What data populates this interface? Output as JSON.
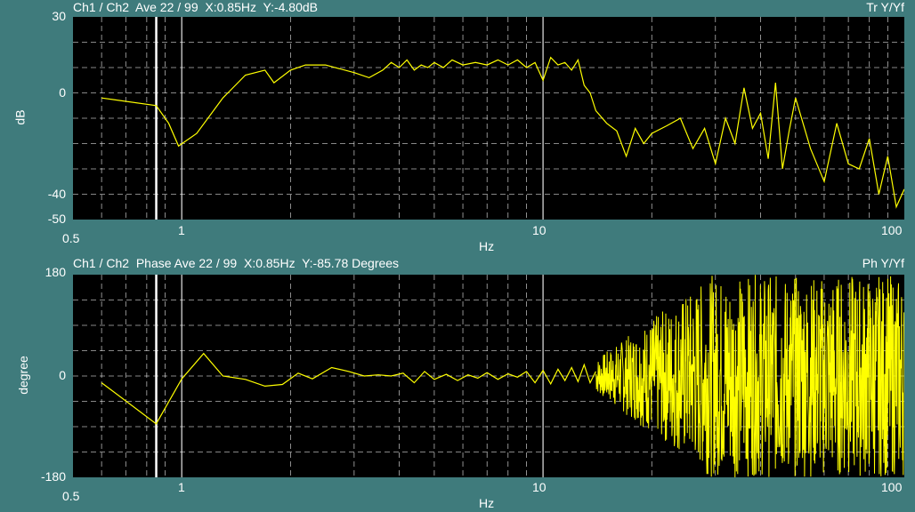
{
  "panels": [
    {
      "title": "Ch1 / Ch2  Ave 22 / 99  X:0.85Hz  Y:-4.80dB",
      "mode": "Tr Y/Yf",
      "ylabel": "dB",
      "xlabel": "Hz",
      "yticks": [
        "30",
        "0",
        "-40",
        "-50"
      ],
      "xticks": [
        "0.5",
        "1",
        "10",
        "100"
      ]
    },
    {
      "title": "Ch1 / Ch2  Phase Ave 22 / 99  X:0.85Hz  Y:-85.78 Degrees",
      "mode": "Ph Y/Yf",
      "ylabel": "degree",
      "xlabel": "Hz",
      "yticks": [
        "180",
        "0",
        "-180"
      ],
      "xticks": [
        "0.5",
        "1",
        "10",
        "100"
      ]
    }
  ],
  "colors": {
    "background": "#3f7b7c",
    "plot": "#000000",
    "trace": "#ffff00",
    "grid": "#ffffff",
    "cursor": "#ffffff"
  },
  "chart_data": [
    {
      "type": "line",
      "xscale": "log",
      "xlim": [
        0.5,
        100
      ],
      "ylim": [
        -50,
        30
      ],
      "cursor_x": 0.85,
      "series": [
        {
          "x": [
            0.6,
            0.85,
            0.92,
            0.98,
            1.1,
            1.3,
            1.5,
            1.7,
            1.8,
            2.0,
            2.2,
            2.5,
            3.0,
            3.3,
            3.6,
            3.8,
            4.0,
            4.2,
            4.4,
            4.6,
            4.8,
            5.0,
            5.3,
            5.6,
            6.0,
            6.5,
            7.0,
            7.5,
            8.0,
            8.5,
            9.0,
            9.5,
            10,
            10.5,
            11,
            11.5,
            12,
            12.5,
            13,
            13.5,
            14,
            15,
            16,
            17,
            18,
            19,
            20,
            22,
            24,
            26,
            28,
            30,
            32,
            34,
            36,
            38,
            40,
            42,
            44,
            46,
            48,
            50,
            55,
            60,
            65,
            70,
            75,
            80,
            85,
            90,
            95,
            100
          ],
          "y": [
            -2,
            -5,
            -12,
            -21,
            -16,
            -2,
            7,
            9,
            4,
            9,
            11,
            11,
            8,
            6,
            9,
            12,
            10,
            13,
            9,
            11,
            10,
            12,
            10,
            13,
            11,
            12,
            11,
            13,
            11,
            13,
            10,
            12,
            5,
            14,
            11,
            12,
            9,
            13,
            3,
            0,
            -7,
            -12,
            -15,
            -25,
            -14,
            -20,
            -16,
            -13,
            -10,
            -22,
            -14,
            -28,
            -10,
            -20,
            2,
            -14,
            -8,
            -26,
            4,
            -30,
            -15,
            -2,
            -22,
            -35,
            -12,
            -28,
            -30,
            -18,
            -40,
            -25,
            -45,
            -38
          ]
        }
      ]
    },
    {
      "type": "line",
      "xscale": "log",
      "xlim": [
        0.5,
        100
      ],
      "ylim": [
        -180,
        180
      ],
      "cursor_x": 0.85,
      "series": [
        {
          "x": [
            0.6,
            0.85,
            1.0,
            1.15,
            1.3,
            1.5,
            1.7,
            1.9,
            2.1,
            2.3,
            2.6,
            2.9,
            3.2,
            3.5,
            3.8,
            4.1,
            4.4,
            4.7,
            5.0,
            5.4,
            5.8,
            6.2,
            6.6,
            7.0,
            7.5,
            8.0,
            8.5,
            9.0,
            9.5,
            10,
            10.5,
            11,
            11.5,
            12,
            12.5,
            13,
            13.5,
            14
          ],
          "y": [
            -12,
            -85,
            -5,
            40,
            0,
            -6,
            -18,
            -15,
            5,
            -5,
            15,
            8,
            0,
            2,
            0,
            5,
            -12,
            8,
            -6,
            3,
            -8,
            2,
            -4,
            6,
            -6,
            4,
            -2,
            8,
            -12,
            10,
            -14,
            12,
            -8,
            15,
            -10,
            20,
            -12,
            8
          ]
        }
      ]
    }
  ]
}
